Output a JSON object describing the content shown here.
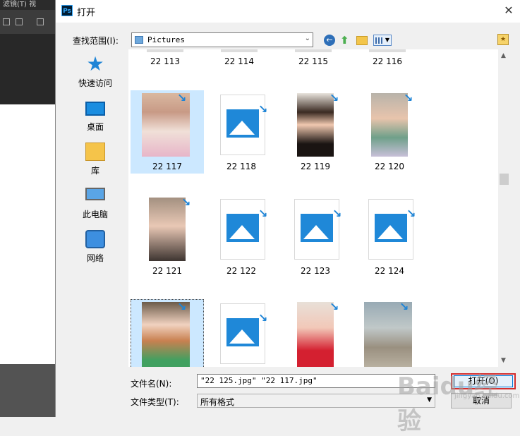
{
  "background": {
    "menubar_text": "滤镜(T)  视"
  },
  "dialog": {
    "title": "打开",
    "app_icon_text": "Ps",
    "close_glyph": "✕"
  },
  "lookin": {
    "label": "查找范围(I):",
    "value": "Pictures"
  },
  "places": [
    {
      "label": "快速访问",
      "icon": "star-icon"
    },
    {
      "label": "桌面",
      "icon": "desktop-icon"
    },
    {
      "label": "库",
      "icon": "library-icon"
    },
    {
      "label": "此电脑",
      "icon": "computer-icon"
    },
    {
      "label": "网络",
      "icon": "network-icon"
    }
  ],
  "files_cut_row": [
    "22 113",
    "22 114",
    "22 115",
    "22 116"
  ],
  "files": [
    {
      "name": "22 117",
      "kind": "photo-baby",
      "state": "selected"
    },
    {
      "name": "22 118",
      "kind": "generic",
      "state": ""
    },
    {
      "name": "22 119",
      "kind": "photo-woman",
      "state": ""
    },
    {
      "name": "22 120",
      "kind": "photo-baby-woman",
      "state": ""
    },
    {
      "name": "22 121",
      "kind": "photo-woman-baby",
      "state": ""
    },
    {
      "name": "22 122",
      "kind": "generic",
      "state": ""
    },
    {
      "name": "22 123",
      "kind": "generic",
      "state": ""
    },
    {
      "name": "22 124",
      "kind": "generic",
      "state": ""
    },
    {
      "name": "",
      "kind": "photo-baby-toys",
      "state": "focused"
    },
    {
      "name": "",
      "kind": "generic",
      "state": ""
    },
    {
      "name": "",
      "kind": "photo-woman-red",
      "state": ""
    },
    {
      "name": "",
      "kind": "photo-outdoor",
      "state": ""
    }
  ],
  "filename": {
    "label": "文件名(N):",
    "value": "\"22 125.jpg\" \"22 117.jpg\""
  },
  "filetype": {
    "label": "文件类型(T):",
    "value": "所有格式"
  },
  "buttons": {
    "open": "打开(O)",
    "cancel": "取消"
  },
  "watermark": {
    "main": "Baidu经验",
    "sub": "jingyan.baidu.com"
  }
}
